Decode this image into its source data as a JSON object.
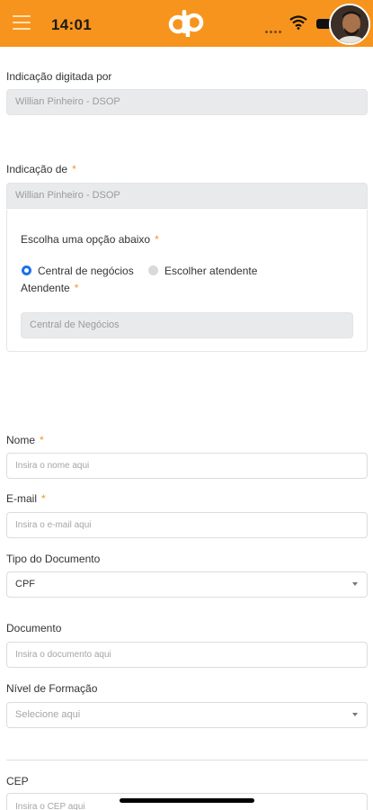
{
  "status_bar": {
    "time": "14:01"
  },
  "header": {
    "logo_icon": "dp-logo-icon",
    "menu_icon": "hamburger-menu-icon",
    "accent": "#f7941d"
  },
  "form": {
    "typed_by": {
      "label": "Indicação digitada por",
      "value": "Willian Pinheiro - DSOP"
    },
    "indication_of": {
      "label": "Indicação de",
      "required": "*",
      "value": "Willian Pinheiro - DSOP"
    },
    "choose": {
      "label": "Escolha uma opção abaixo",
      "required": "*",
      "options": [
        {
          "label": "Central de negócios",
          "selected": true
        },
        {
          "label": "Escolher atendente",
          "selected": false
        }
      ]
    },
    "attendant": {
      "label": "Atendente",
      "required": "*",
      "value": "Central de Negócios"
    },
    "name": {
      "label": "Nome",
      "required": "*",
      "placeholder": "Insira o nome aqui"
    },
    "email": {
      "label": "E-mail",
      "required": "*",
      "placeholder": "Insira o e-mail aqui"
    },
    "doc_type": {
      "label": "Tipo do Documento",
      "value": "CPF"
    },
    "document": {
      "label": "Documento",
      "placeholder": "Insira o documento aqui"
    },
    "education": {
      "label": "Nível de Formação",
      "placeholder": "Selecione aqui"
    },
    "cep": {
      "label": "CEP",
      "placeholder": "Insira o CEP aqui"
    }
  }
}
